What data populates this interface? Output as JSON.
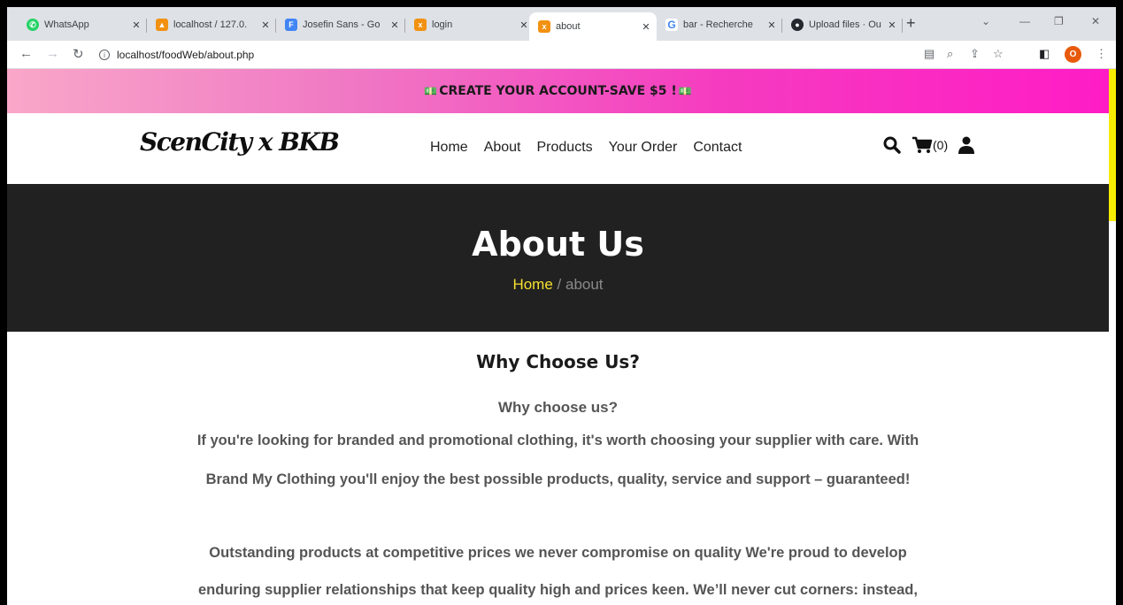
{
  "browser": {
    "tabs": [
      {
        "label": "WhatsApp",
        "favicon_color": "#25d366",
        "favicon_icon": "whatsapp-icon"
      },
      {
        "label": "localhost / 127.0.",
        "favicon_color": "#f29111",
        "favicon_icon": "phpmyadmin-icon"
      },
      {
        "label": "Josefin Sans - Go",
        "favicon_color": "#4285f4",
        "favicon_icon": "google-fonts-icon"
      },
      {
        "label": "login",
        "favicon_color": "#f29111",
        "favicon_icon": "xampp-icon"
      },
      {
        "label": "about",
        "favicon_color": "#f29111",
        "favicon_icon": "xampp-icon",
        "active": true
      },
      {
        "label": "bar - Recherche",
        "favicon_color": "#4285f4",
        "favicon_icon": "google-icon"
      },
      {
        "label": "Upload files · Ou",
        "favicon_color": "#24292f",
        "favicon_icon": "github-icon"
      }
    ],
    "url": "localhost/foodWeb/about.php",
    "profile_initial": "O"
  },
  "promo": {
    "text": "CREATE YOUR ACCOUNT-SAVE $5 !",
    "bg_start": "#f9a7c9",
    "bg_end": "#ff1cc5"
  },
  "header": {
    "logo": "ScenCity x BKB",
    "nav": [
      "Home",
      "About",
      "Products",
      "Your Order",
      "Contact"
    ],
    "cart_count": "(0)"
  },
  "hero": {
    "title": "About Us",
    "crumb_home": "Home",
    "crumb_sep": " / ",
    "crumb_current": "about",
    "bg_color": "#212121",
    "accent": "#f6e030"
  },
  "content": {
    "title": "Why Choose Us?",
    "subtitle": "Why choose us?",
    "para1_line1": "If you're looking for branded and promotional clothing, it's worth choosing your supplier with care. With",
    "para1_line2": "Brand My Clothing you'll enjoy the best possible products, quality, service and support – guaranteed!",
    "para2_line1": "Outstanding products at competitive prices we never compromise on quality We're proud to develop",
    "para2_line2": "enduring supplier relationships that keep quality high and prices keen. We’ll never cut corners: instead,"
  }
}
